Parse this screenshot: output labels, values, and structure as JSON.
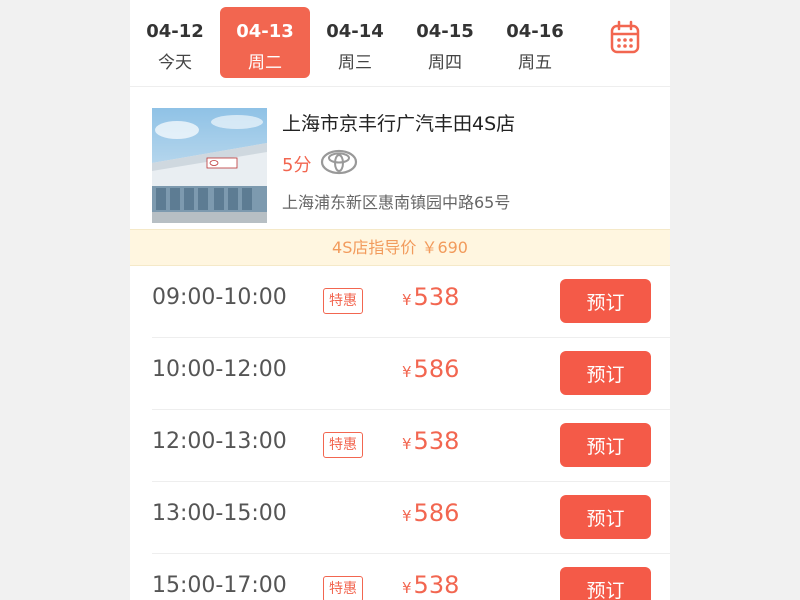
{
  "dates": [
    {
      "date": "04-12",
      "weekday": "今天",
      "active": false
    },
    {
      "date": "04-13",
      "weekday": "周二",
      "active": true
    },
    {
      "date": "04-14",
      "weekday": "周三",
      "active": false
    },
    {
      "date": "04-15",
      "weekday": "周四",
      "active": false
    },
    {
      "date": "04-16",
      "weekday": "周五",
      "active": false
    }
  ],
  "calendar_icon": "calendar-icon",
  "store": {
    "name": "上海市京丰行广汽丰田4S店",
    "rating": "5分",
    "brand_icon": "toyota-logo",
    "address": "上海浦东新区惠南镇园中路65号"
  },
  "guide_price": "4S店指导价 ￥690",
  "slots": [
    {
      "time": "09:00-10:00",
      "badge": "特惠",
      "currency": "¥",
      "price": "538",
      "button": "预订"
    },
    {
      "time": "10:00-12:00",
      "badge": "",
      "currency": "¥",
      "price": "586",
      "button": "预订"
    },
    {
      "time": "12:00-13:00",
      "badge": "特惠",
      "currency": "¥",
      "price": "538",
      "button": "预订"
    },
    {
      "time": "13:00-15:00",
      "badge": "",
      "currency": "¥",
      "price": "586",
      "button": "预订"
    },
    {
      "time": "15:00-17:00",
      "badge": "特惠",
      "currency": "¥",
      "price": "538",
      "button": "预订"
    }
  ],
  "colors": {
    "accent": "#f26650",
    "button": "#f45a48",
    "guide_bg": "#fff6e0",
    "guide_text": "#f29b5c"
  }
}
